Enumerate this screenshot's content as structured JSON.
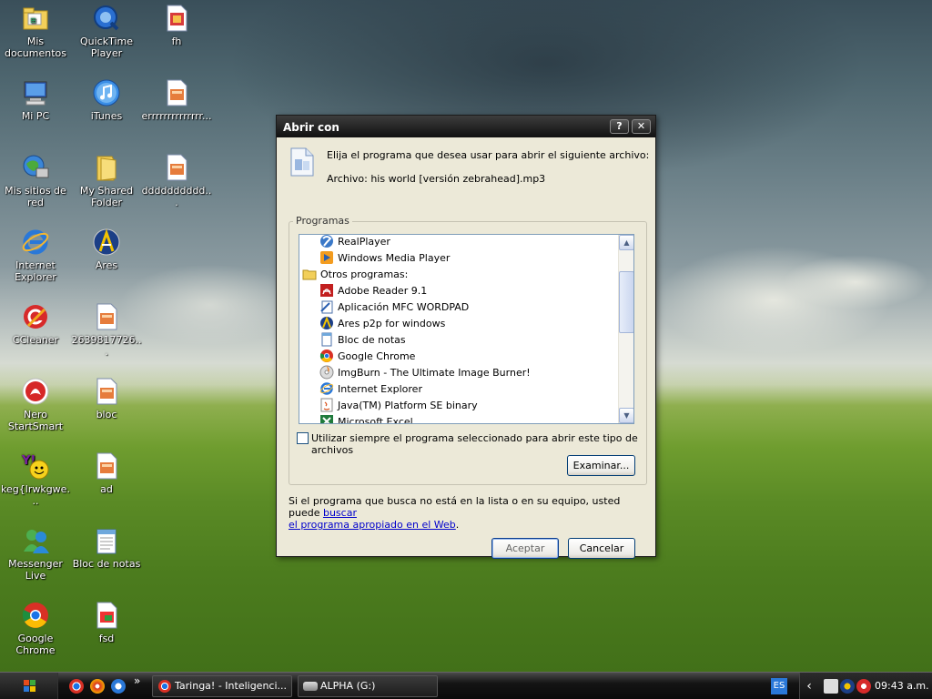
{
  "desktop": {
    "icons": [
      {
        "label": "Mis documentos"
      },
      {
        "label": "QuickTime Player"
      },
      {
        "label": "fh"
      },
      {
        "label": "Mi PC"
      },
      {
        "label": "iTunes"
      },
      {
        "label": "errrrrrrrrrrrrr..."
      },
      {
        "label": "Mis sitios de red"
      },
      {
        "label": "My Shared Folder"
      },
      {
        "label": "dddddddddd..."
      },
      {
        "label": "Internet Explorer"
      },
      {
        "label": "Ares"
      },
      {
        "label": "CCleaner"
      },
      {
        "label": "2639817726..."
      },
      {
        "label": "Nero StartSmart"
      },
      {
        "label": "bloc"
      },
      {
        "label": "keg{lrwkgwe..."
      },
      {
        "label": "ad"
      },
      {
        "label": "Messenger Live"
      },
      {
        "label": "Bloc de notas"
      },
      {
        "label": "Google Chrome"
      },
      {
        "label": "fsd"
      }
    ]
  },
  "dialog": {
    "title": "Abrir con",
    "help_label": "?",
    "close_label": "✕",
    "instruction": "Elija el programa que desea usar para abrir el siguiente archivo:",
    "file_line": "Archivo: his world [versión zebrahead].mp3",
    "programs_group": "Programas",
    "list_items": [
      {
        "label": "RealPlayer",
        "icon": "realplayer-icon"
      },
      {
        "label": "Windows Media Player",
        "icon": "wmp-icon"
      },
      {
        "label": "Otros programas:",
        "icon": "folder-icon"
      },
      {
        "label": "Adobe Reader 9.1",
        "icon": "adobe-reader-icon"
      },
      {
        "label": "Aplicación MFC WORDPAD",
        "icon": "wordpad-icon"
      },
      {
        "label": "Ares p2p for windows",
        "icon": "ares-icon"
      },
      {
        "label": "Bloc de notas",
        "icon": "notepad-icon"
      },
      {
        "label": "Google Chrome",
        "icon": "chrome-icon"
      },
      {
        "label": "ImgBurn - The Ultimate Image Burner!",
        "icon": "imgburn-icon"
      },
      {
        "label": "Internet Explorer",
        "icon": "ie-icon"
      },
      {
        "label": "Java(TM) Platform SE binary",
        "icon": "java-icon"
      },
      {
        "label": "Microsoft Excel",
        "icon": "excel-icon"
      }
    ],
    "always_use_label": "Utilizar siempre el programa seleccionado para abrir este tipo de archivos",
    "always_use_checked": false,
    "browse_label": "Examinar...",
    "help_text_prefix": "Si el programa que busca no está en la lista o en su equipo, usted puede ",
    "help_link_1": "buscar",
    "help_link_2": "el programa apropiado en el Web",
    "help_text_suffix": ".",
    "ok_label": "Aceptar",
    "cancel_label": "Cancelar"
  },
  "taskbar": {
    "quick_launch_more": "»",
    "buttons": [
      {
        "label": "Taringa! - Inteligenci...",
        "icon": "chrome-icon"
      },
      {
        "label": "ALPHA (G:)",
        "icon": "drive-icon"
      }
    ],
    "language": "ES",
    "tray_expand": "‹",
    "clock": "09:43 a.m."
  },
  "colors": {
    "dialog_bg": "#ece9d8",
    "titlebar_dark": "#111111",
    "link": "#0000cc"
  }
}
